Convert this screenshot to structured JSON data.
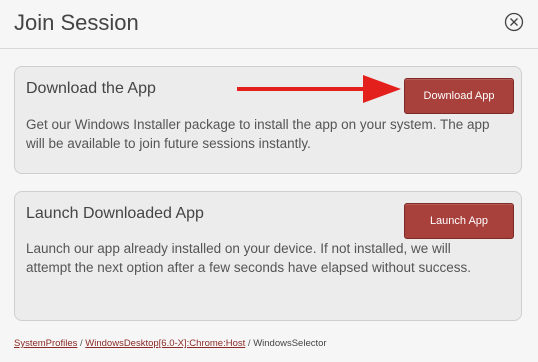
{
  "dialog": {
    "title": "Join Session",
    "close_icon": "close-circle-icon"
  },
  "download_card": {
    "title": "Download the App",
    "description": "Get our Windows Installer package to install the app on your system. The app will be available to join future sessions instantly.",
    "button_label": "Download App"
  },
  "launch_card": {
    "title": "Launch Downloaded App",
    "description": "Launch our app already installed on your device. If not installed, we will attempt the next option after a few seconds have elapsed without success.",
    "button_label": "Launch App"
  },
  "breadcrumb": {
    "items": [
      "SystemProfiles",
      "WindowsDesktop[6.0-X]:Chrome:Host",
      "WindowsSelector"
    ],
    "separator": "/"
  },
  "colors": {
    "button": "#a8403c",
    "link": "#8b2a26",
    "arrow": "#e3201b"
  }
}
